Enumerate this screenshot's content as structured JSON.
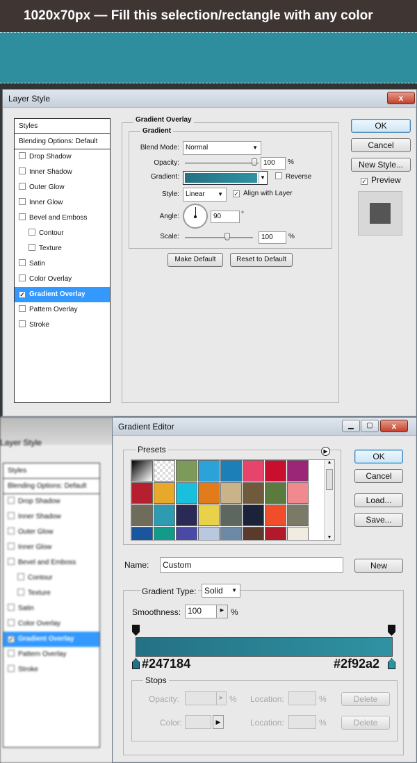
{
  "banner": {
    "text": "1020x70px — Fill this selection/rectangle with any color"
  },
  "fill_color": "#2f8e9e",
  "layer_style": {
    "title": "Layer Style",
    "close_label": "x",
    "styles_header": "Styles",
    "blending": "Blending Options: Default",
    "items": [
      "Drop Shadow",
      "Inner Shadow",
      "Outer Glow",
      "Inner Glow",
      "Bevel and Emboss",
      "Contour",
      "Texture",
      "Satin",
      "Color Overlay",
      "Gradient Overlay",
      "Pattern Overlay",
      "Stroke"
    ],
    "checked_item": "Gradient Overlay",
    "group_title": "Gradient Overlay",
    "subgroup_title": "Gradient",
    "blend_mode_label": "Blend Mode:",
    "blend_mode": "Normal",
    "opacity_label": "Opacity:",
    "opacity": "100",
    "percent": "%",
    "gradient_label": "Gradient:",
    "reverse_label": "Reverse",
    "style_label": "Style:",
    "style": "Linear",
    "align_label": "Align with Layer",
    "angle_label": "Angle:",
    "angle": "90",
    "degree": "°",
    "scale_label": "Scale:",
    "scale": "100",
    "make_default": "Make Default",
    "reset_default": "Reset to Default",
    "ok": "OK",
    "cancel": "Cancel",
    "new_style": "New Style...",
    "preview_label": "Preview"
  },
  "gradient_editor": {
    "title": "Gradient Editor",
    "presets_label": "Presets",
    "ok": "OK",
    "cancel": "Cancel",
    "load": "Load...",
    "save": "Save...",
    "name_label": "Name:",
    "name_value": "Custom",
    "new_label": "New",
    "type_label": "Gradient Type:",
    "type_value": "Solid",
    "smooth_label": "Smoothness:",
    "smooth_value": "100",
    "percent": "%",
    "left_color": "#247184",
    "right_color": "#2f92a2",
    "stops_label": "Stops",
    "opacity_label": "Opacity:",
    "location_label": "Location:",
    "color_label": "Color:",
    "delete_label": "Delete"
  },
  "bg_dialog": {
    "title": "Layer Style",
    "styles_header": "Styles",
    "blending": "Blending Options: Default",
    "items": [
      "Drop Shadow",
      "Inner Shadow",
      "Outer Glow",
      "Inner Glow",
      "Bevel and Emboss",
      "Contour",
      "Texture",
      "Satin",
      "Color Overlay",
      "Gradient Overlay",
      "Pattern Overlay",
      "Stroke"
    ]
  },
  "presets": [
    "#101010",
    "#c8c8c8",
    "#7c9a5a",
    "#2ba3d8",
    "#1d7fb8",
    "#e6446a",
    "#c8102e",
    "#9b2677",
    "#b51f2e",
    "#e8a92a",
    "#19c0de",
    "#e27b1a",
    "#c9b48a",
    "#6f5a3c",
    "#5a7a3e",
    "#f08a8e",
    "#6f6c5c",
    "#2f9bb0",
    "#2a2a56",
    "#e8d24a",
    "#5e6660",
    "#1c2238",
    "#f04e2a",
    "#7a7a66",
    "#1a56a0",
    "#129a8a",
    "#4a4aa6",
    "#b8c8e0",
    "#6c8aa8",
    "#5a3a2a",
    "#b01a2a",
    "#f0ece0"
  ]
}
